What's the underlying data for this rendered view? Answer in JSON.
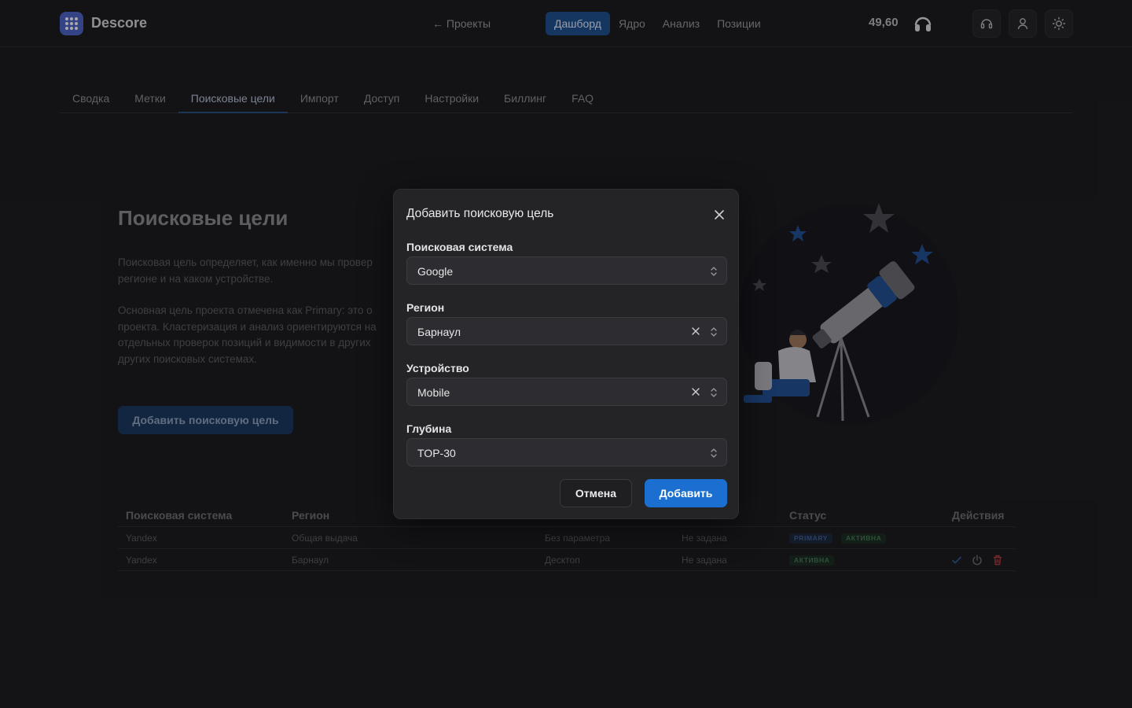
{
  "header": {
    "brand": "Descore",
    "back_link": "← Проекты",
    "nav": [
      "Дашборд",
      "Ядро",
      "Анализ",
      "Позиции"
    ],
    "active_nav": "Дашборд",
    "balance": "49,60"
  },
  "tabs": [
    "Сводка",
    "Метки",
    "Поисковые цели",
    "Импорт",
    "Доступ",
    "Настройки",
    "Биллинг",
    "FAQ"
  ],
  "active_tab": "Поисковые цели",
  "hero": {
    "title": "Поисковые цели",
    "p1": [
      "Поисковая цель определяет, как именно мы провер",
      "регионе и на каком устройстве."
    ],
    "p2": [
      "Основная цель проекта отмечена как Primary: это о",
      "проекта. Кластеризация и анализ ориентируются на",
      "отдельных проверок позиций и видимости в других",
      "других поисковых системах."
    ],
    "button": "Добавить поисковую цель"
  },
  "table": {
    "headers": [
      "Поисковая система",
      "Регион",
      "Статус",
      "Действия"
    ],
    "rows": [
      {
        "engine": "Yandex",
        "region": "Общая выдача",
        "device": "Без параметра",
        "depth": "Не задана",
        "badges": [
          "PRIMARY",
          "АКТИВНА"
        ]
      },
      {
        "engine": "Yandex",
        "region": "Барнаул",
        "device": "Десктоп",
        "depth": "Не задана",
        "badges": [
          "АКТИВНА"
        ]
      }
    ]
  },
  "modal": {
    "title": "Добавить поисковую цель",
    "fields": [
      {
        "label": "Поисковая система",
        "value": "Google",
        "clearable": false
      },
      {
        "label": "Регион",
        "value": "Барнаул",
        "clearable": true
      },
      {
        "label": "Устройство",
        "value": "Mobile",
        "clearable": true
      },
      {
        "label": "Глубина",
        "value": "TOP-30",
        "clearable": false
      }
    ],
    "cancel": "Отмена",
    "submit": "Добавить"
  },
  "colors": {
    "accent": "#1a6fd1",
    "nav_active": "#1d4f8f",
    "badge_primary": "#3c5f99",
    "badge_active": "#3f7a4e",
    "delete": "#b33a3a"
  }
}
